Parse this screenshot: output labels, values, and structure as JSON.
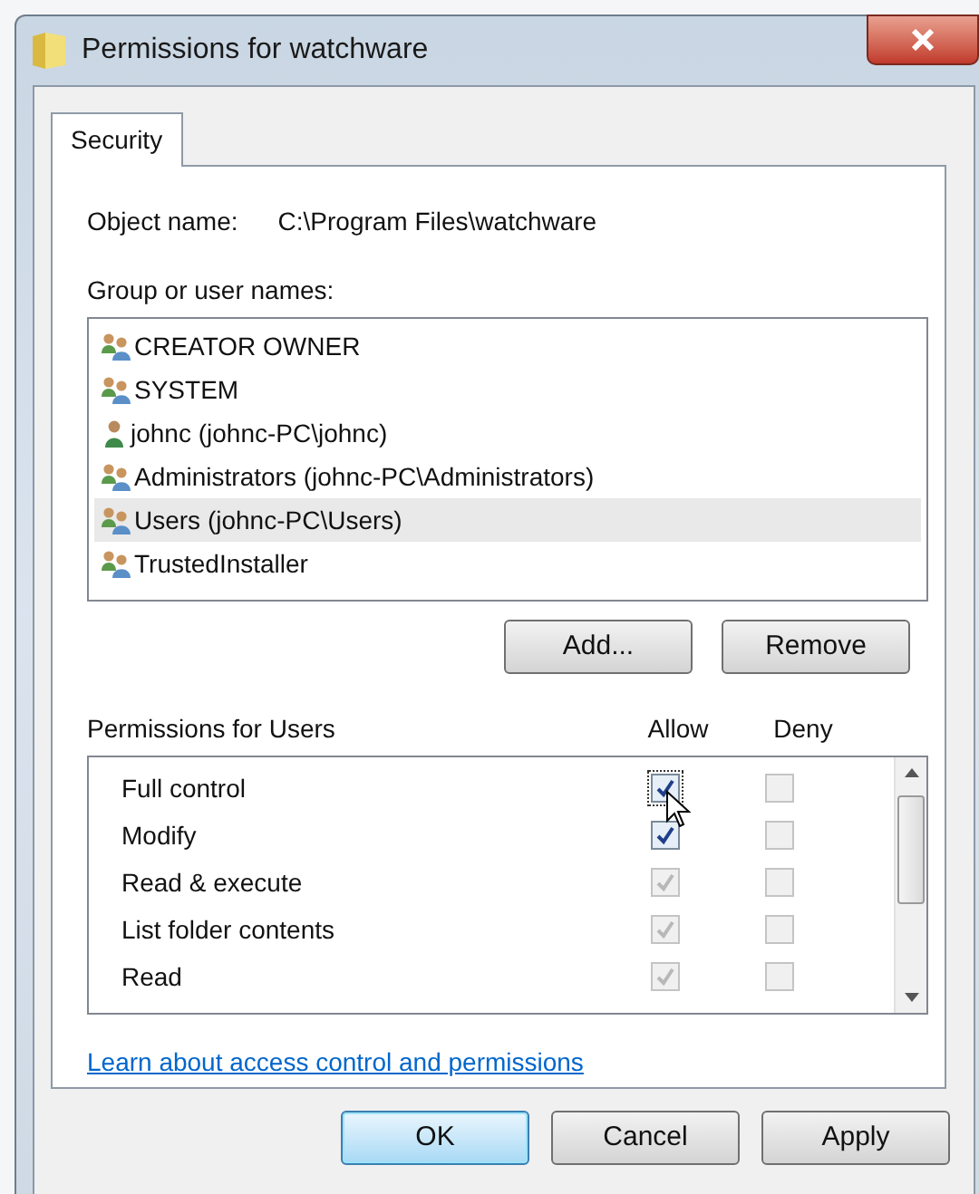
{
  "window": {
    "title": "Permissions for watchware"
  },
  "tabs": [
    {
      "label": "Security",
      "selected": true
    }
  ],
  "object_name": {
    "label": "Object name:",
    "value": "C:\\Program Files\\watchware"
  },
  "group_list": {
    "label": "Group or user names:",
    "items": [
      {
        "name": "CREATOR OWNER",
        "kind": "group",
        "selected": false
      },
      {
        "name": "SYSTEM",
        "kind": "group",
        "selected": false
      },
      {
        "name": "johnc (johnc-PC\\johnc)",
        "kind": "user",
        "selected": false
      },
      {
        "name": "Administrators (johnc-PC\\Administrators)",
        "kind": "group",
        "selected": false
      },
      {
        "name": "Users (johnc-PC\\Users)",
        "kind": "group",
        "selected": true
      },
      {
        "name": "TrustedInstaller",
        "kind": "group",
        "selected": false
      }
    ]
  },
  "list_buttons": [
    "Add...",
    "Remove"
  ],
  "permissions": {
    "label": "Permissions for Users",
    "allow_label": "Allow",
    "deny_label": "Deny",
    "rows": [
      {
        "name": "Full control",
        "allow": {
          "checked": true,
          "disabled": false
        },
        "deny": {
          "checked": false,
          "disabled": true
        }
      },
      {
        "name": "Modify",
        "allow": {
          "checked": true,
          "disabled": false
        },
        "deny": {
          "checked": false,
          "disabled": true
        }
      },
      {
        "name": "Read & execute",
        "allow": {
          "checked": true,
          "disabled": true
        },
        "deny": {
          "checked": false,
          "disabled": true
        }
      },
      {
        "name": "List folder contents",
        "allow": {
          "checked": true,
          "disabled": true
        },
        "deny": {
          "checked": false,
          "disabled": true
        }
      },
      {
        "name": "Read",
        "allow": {
          "checked": true,
          "disabled": true
        },
        "deny": {
          "checked": false,
          "disabled": true
        }
      }
    ]
  },
  "link": "Learn about access control and permissions",
  "buttons": [
    {
      "label": "OK",
      "kind": "default"
    },
    {
      "label": "Cancel",
      "kind": "normal"
    },
    {
      "label": "Apply",
      "kind": "normal"
    }
  ]
}
